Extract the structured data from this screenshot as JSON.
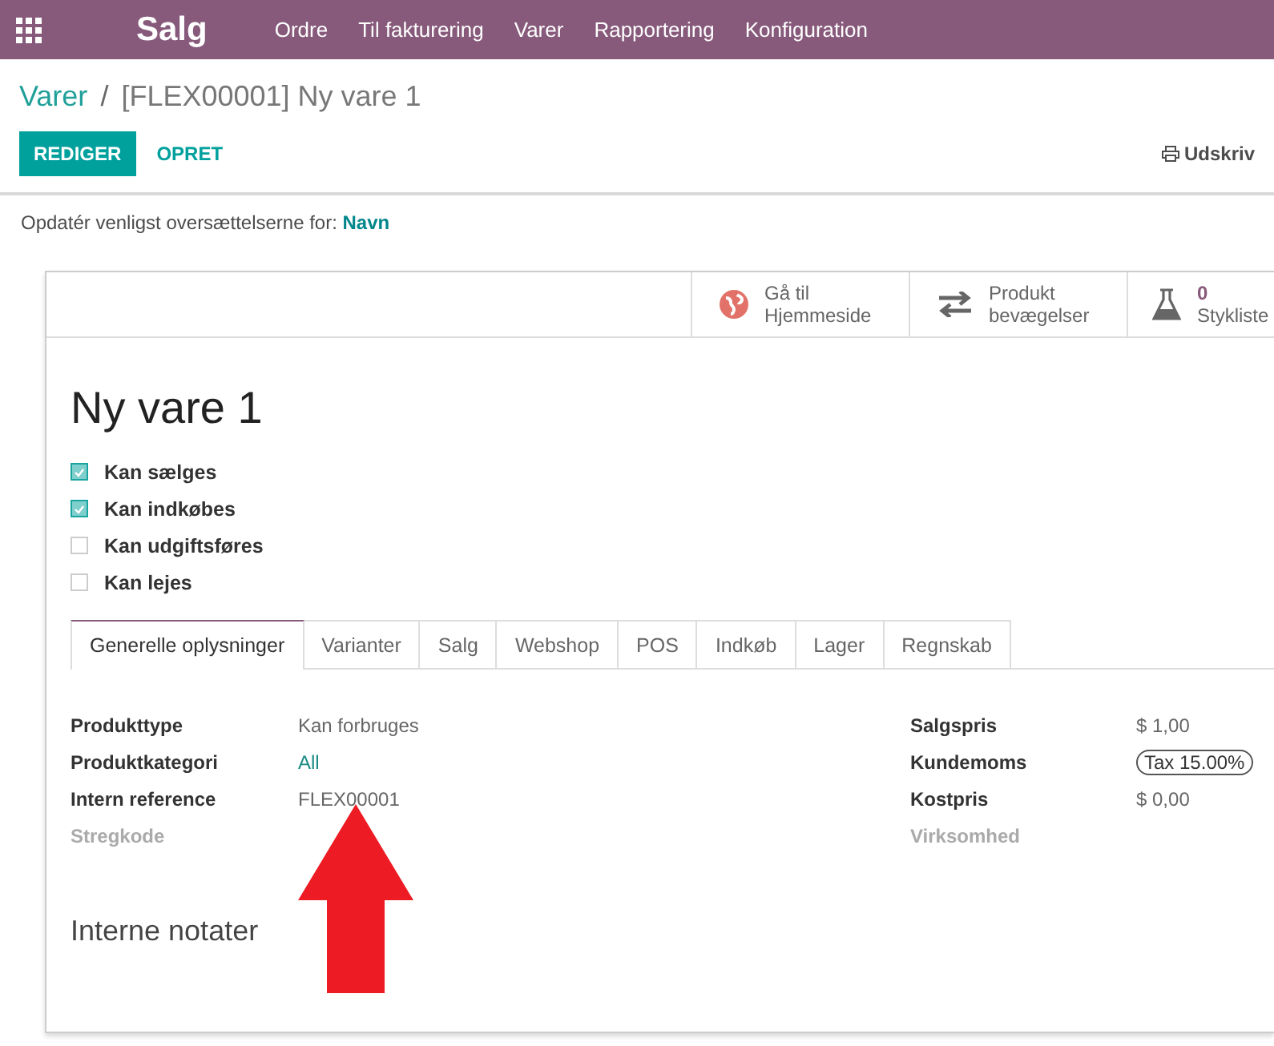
{
  "navbar": {
    "app": "Salg",
    "menu": [
      "Ordre",
      "Til fakturering",
      "Varer",
      "Rapportering",
      "Konfiguration"
    ]
  },
  "breadcrumb": {
    "parent": "Varer",
    "separator": "/",
    "current": "[FLEX00001] Ny vare 1"
  },
  "buttons": [
    {
      "label": "REDIGER",
      "kind": "primary"
    },
    {
      "label": "OPRET",
      "kind": "link"
    }
  ],
  "print": "Udskriv",
  "notice": {
    "text": "Opdatér venligst oversættelserne for:",
    "field": "Navn"
  },
  "stat_buttons": [
    {
      "kind": "globe",
      "line1": "Gå til",
      "line2": "Hjemmeside"
    },
    {
      "kind": "arrows",
      "line1": "Produkt",
      "line2": "bevægelser"
    },
    {
      "kind": "flask",
      "line1": "0",
      "line2": "Stykliste"
    }
  ],
  "product": {
    "name": "Ny vare 1",
    "options": [
      {
        "label": "Kan sælges",
        "checked": true
      },
      {
        "label": "Kan indkøbes",
        "checked": true
      },
      {
        "label": "Kan udgiftsføres",
        "checked": false
      },
      {
        "label": "Kan lejes",
        "checked": false
      }
    ]
  },
  "tabs": [
    {
      "label": "Generelle oplysninger",
      "selected": true
    },
    {
      "label": "Varianter",
      "selected": false
    },
    {
      "label": "Salg",
      "selected": false
    },
    {
      "label": "Webshop",
      "selected": false
    },
    {
      "label": "POS",
      "selected": false
    },
    {
      "label": "Indkøb",
      "selected": false
    },
    {
      "label": "Lager",
      "selected": false
    },
    {
      "label": "Regnskab",
      "selected": false
    }
  ],
  "left_fields": [
    {
      "label": "Produkttype",
      "value": "Kan forbruges",
      "kind": "text"
    },
    {
      "label": "Produktkategori",
      "value": "All",
      "kind": "link"
    },
    {
      "label": "Intern reference",
      "value": "FLEX00001",
      "kind": "text"
    },
    {
      "label": "Stregkode",
      "kind": "empty"
    }
  ],
  "right_fields": [
    {
      "label": "Salgspris",
      "value": "$ 1,00",
      "kind": "text"
    },
    {
      "label": "Kundemoms",
      "value": "Tax 15.00%",
      "kind": "tag"
    },
    {
      "label": "Kostpris",
      "value": "$ 0,00",
      "kind": "text"
    },
    {
      "label": "Virksomhed",
      "kind": "empty"
    }
  ],
  "notes_heading": "Interne notater"
}
